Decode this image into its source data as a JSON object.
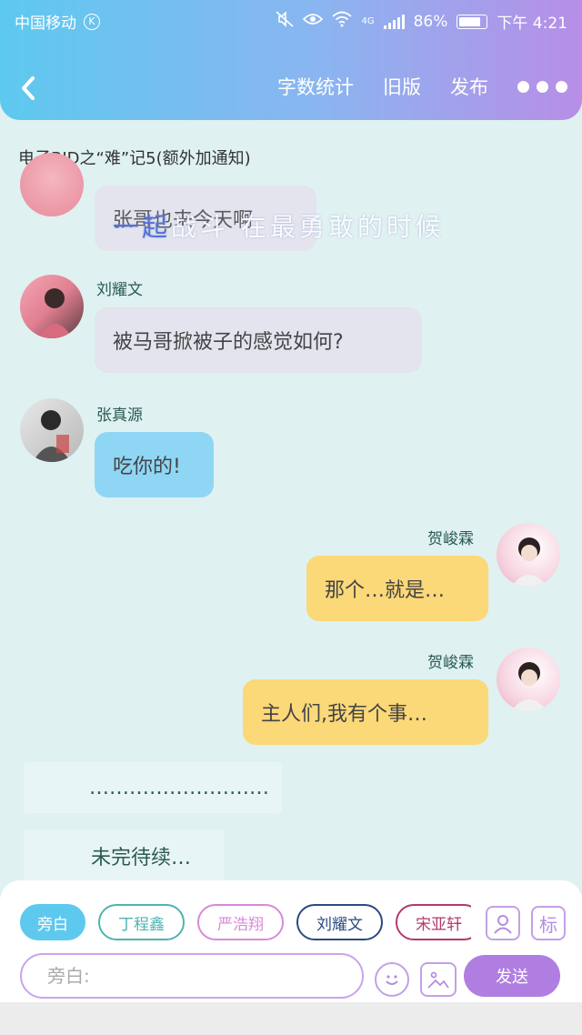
{
  "status_bar": {
    "carrier": "中国移动",
    "carrier_badge": "K",
    "network": "4G",
    "battery": "86%",
    "battery_level": 0.86,
    "time": "下午 4:21"
  },
  "header": {
    "back_icon": "chevron-left-icon",
    "actions": [
      "字数统计",
      "旧版",
      "发布"
    ],
    "more_icon": "more-dots-icon"
  },
  "document": {
    "title": "电子BJD之“难”记5(额外加通知)"
  },
  "messages": [
    {
      "side": "left",
      "name": "",
      "text": "张哥也来今天啊"
    },
    {
      "side": "left",
      "name": "刘耀文",
      "text": "被马哥掀被子的感觉如何?"
    },
    {
      "side": "left",
      "name": "张真源",
      "text": "吃你的!"
    },
    {
      "side": "right",
      "name": "贺峻霖",
      "text": "那个…就是…"
    },
    {
      "side": "right",
      "name": "贺峻霖",
      "text": "主人们,我有个事…"
    }
  ],
  "narrations": [
    {
      "text": "………………………"
    },
    {
      "text": "未完待续…"
    }
  ],
  "overlay": {
    "highlight": "一起",
    "rest": "战斗 在最勇敢的时候"
  },
  "composer": {
    "chips": [
      {
        "label": "旁白",
        "color": "#5ec9ef"
      },
      {
        "label": "丁程鑫",
        "color": "#4fb4b0"
      },
      {
        "label": "严浩翔",
        "color": "#d88ad8"
      },
      {
        "label": "刘耀文",
        "color": "#2a4a80"
      },
      {
        "label": "宋亚轩",
        "color": "#b23a6e"
      }
    ],
    "role_icon": "role-card-icon",
    "tag_button_label": "标",
    "input_placeholder": "旁白:",
    "emoji_icon": "smiley-icon",
    "image_icon": "image-icon",
    "send_label": "发送"
  }
}
